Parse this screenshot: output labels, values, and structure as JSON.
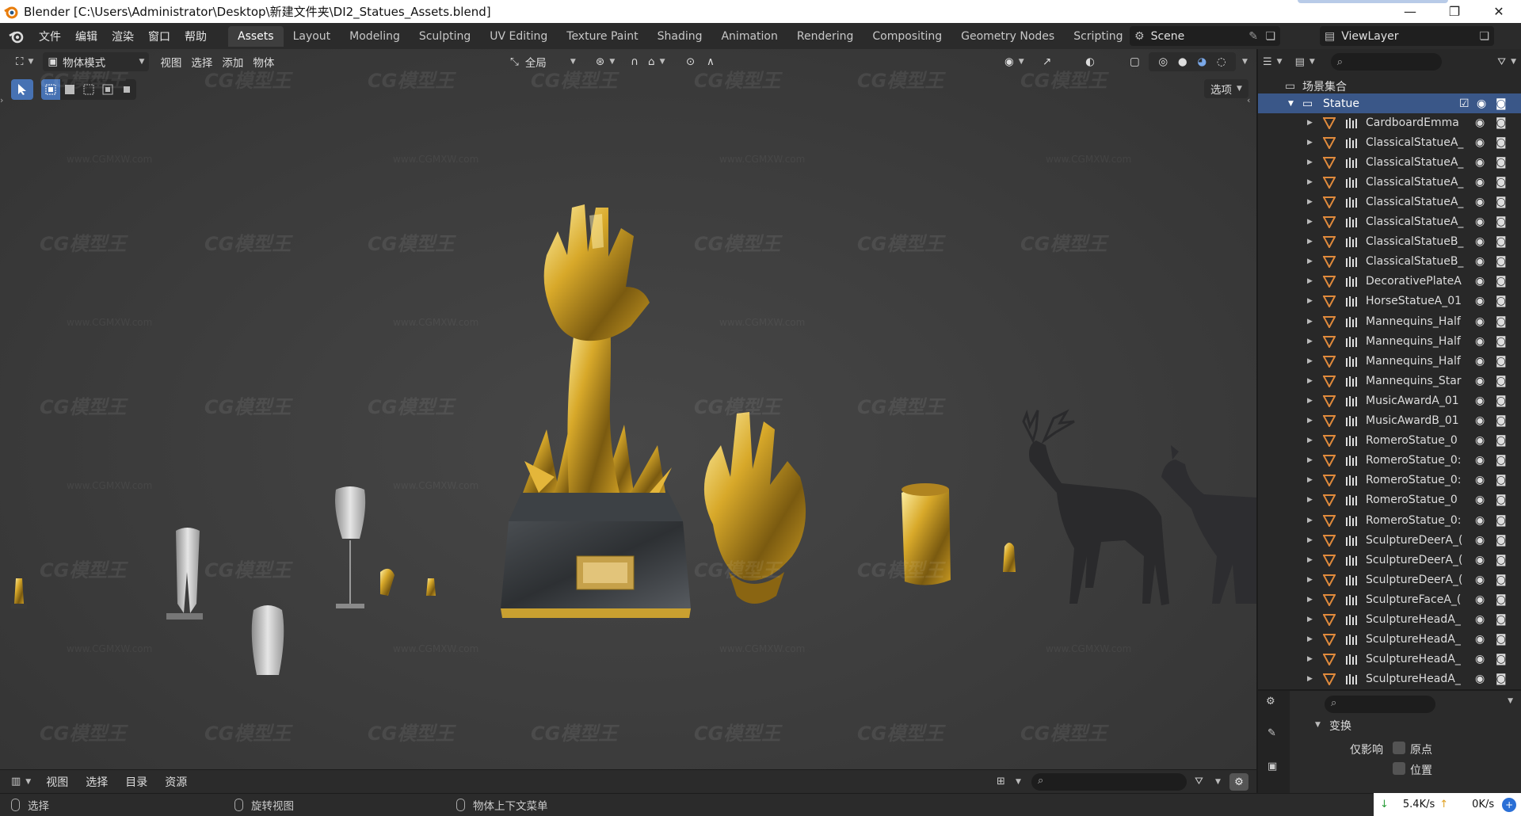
{
  "window": {
    "title": "Blender [C:\\Users\\Administrator\\Desktop\\新建文件夹\\DI2_Statues_Assets.blend]",
    "controls": [
      "—",
      "❐",
      "✕"
    ]
  },
  "menu": [
    "文件",
    "编辑",
    "渲染",
    "窗口",
    "帮助"
  ],
  "workspaces": {
    "active": "Assets",
    "tabs": [
      "Assets",
      "Layout",
      "Modeling",
      "Sculpting",
      "UV Editing",
      "Texture Paint",
      "Shading",
      "Animation",
      "Rendering",
      "Compositing",
      "Geometry Nodes",
      "Scripting"
    ],
    "add": "+"
  },
  "scene": {
    "name": "Scene",
    "view_layer": "ViewLayer"
  },
  "viewport": {
    "mode": "物体模式",
    "menus": [
      "视图",
      "选择",
      "添加",
      "物体"
    ],
    "transform_orientation": "全局",
    "options_label": "选项",
    "watermark": "CG模型王",
    "watermark_url": "www.CGMXW.com"
  },
  "outliner": {
    "root": "场景集合",
    "collection": "Statue",
    "items": [
      "CardboardEmma",
      "ClassicalStatueA_",
      "ClassicalStatueA_",
      "ClassicalStatueA_",
      "ClassicalStatueA_",
      "ClassicalStatueA_",
      "ClassicalStatueB_",
      "ClassicalStatueB_",
      "DecorativePlateA",
      "HorseStatueA_01",
      "Mannequins_Half",
      "Mannequins_Half",
      "Mannequins_Half",
      "Mannequins_Star",
      "MusicAwardA_01",
      "MusicAwardB_01",
      "RomeroStatue_0",
      "RomeroStatue_0:",
      "RomeroStatue_0:",
      "RomeroStatue_0",
      "RomeroStatue_0:",
      "SculptureDeerA_(",
      "SculptureDeerA_(",
      "SculptureDeerA_(",
      "SculptureFaceA_(",
      "SculptureHeadA_",
      "SculptureHeadA_",
      "SculptureHeadA_",
      "SculptureHeadA_"
    ]
  },
  "properties": {
    "panel": "变换",
    "affect_only": "仅影响",
    "origin": "原点",
    "location": "位置"
  },
  "asset_browser": {
    "menus": [
      "视图",
      "选择",
      "目录",
      "资源"
    ]
  },
  "status": {
    "select": "选择",
    "rotate": "旋转视图",
    "context": "物体上下文菜单",
    "net_down": "5.4K/s",
    "net_up": "0K/s"
  },
  "colors": {
    "accent": "#4772b3",
    "collection_highlight": "#3a5788",
    "mesh_orange": "#e08a3c",
    "gold": "#d4a72c"
  }
}
